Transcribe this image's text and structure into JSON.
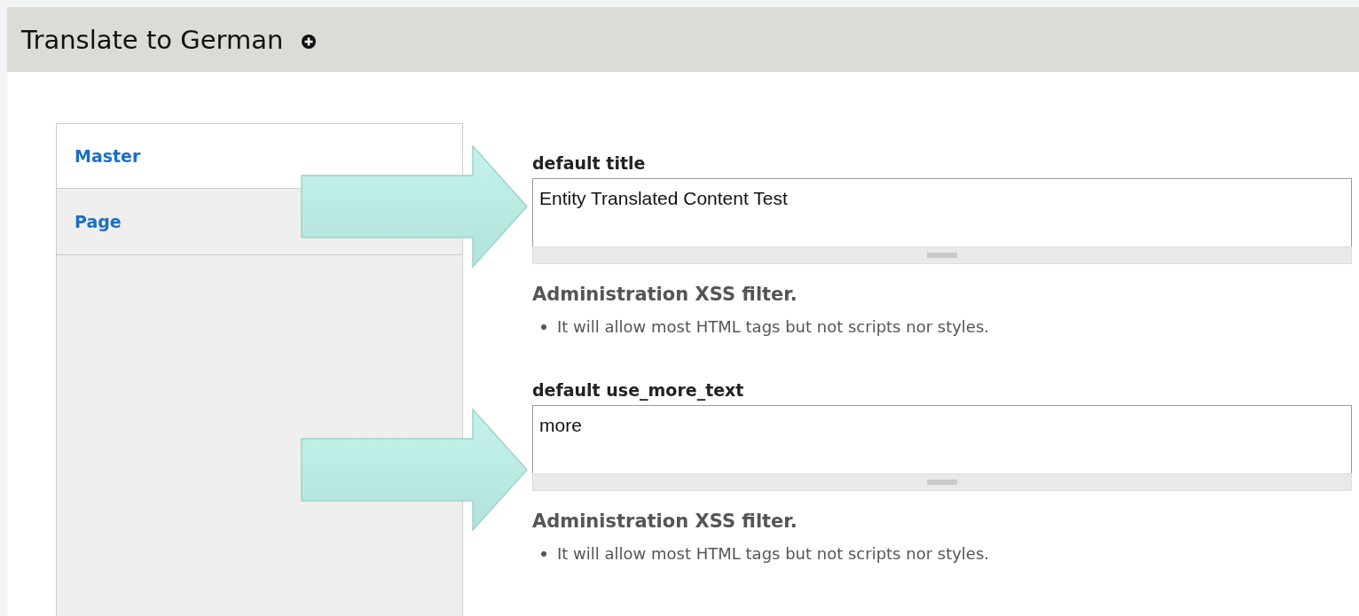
{
  "header": {
    "title": "Translate to German"
  },
  "tabs": [
    {
      "label": "Master",
      "selected": true
    },
    {
      "label": "Page",
      "selected": false
    }
  ],
  "fields": [
    {
      "label": "default title",
      "value": "Entity Translated Content Test",
      "filter_title": "Administration XSS filter.",
      "filter_tips": [
        "It will allow most HTML tags but not scripts nor styles."
      ]
    },
    {
      "label": "default use_more_text",
      "value": "more",
      "filter_title": "Administration XSS filter.",
      "filter_tips": [
        "It will allow most HTML tags but not scripts nor styles."
      ]
    }
  ]
}
